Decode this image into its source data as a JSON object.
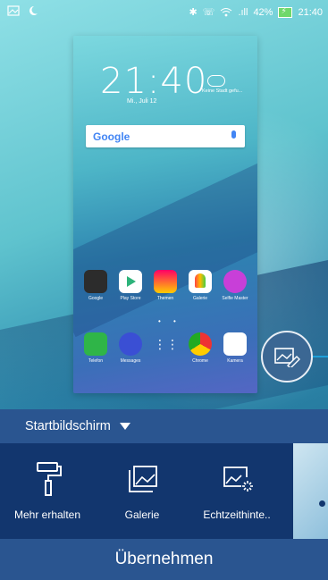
{
  "status_bar": {
    "battery": "42%",
    "time": "21:40",
    "icons": [
      "image-icon",
      "moon-icon",
      "bluetooth-icon",
      "call-icon",
      "wifi-icon",
      "signal-icon",
      "battery-icon"
    ]
  },
  "preview": {
    "clock": "21:40",
    "date": "Mi., Juli 12",
    "weather": "Keine Stadt gefu...",
    "search_logo": "Google",
    "apps_row1": [
      "Google",
      "Play Store",
      "Themen",
      "Galerie",
      "Selfie Master"
    ],
    "apps_row2": [
      "Telefon",
      "Messages",
      "",
      "Chrome",
      "Kamera"
    ]
  },
  "panel": {
    "dropdown_label": "Startbildschirm",
    "options": [
      {
        "label": "Mehr erhalten",
        "icon": "paint-roller-icon"
      },
      {
        "label": "Galerie",
        "icon": "gallery-icon"
      },
      {
        "label": "Echtzeithinte..",
        "icon": "live-wallpaper-icon"
      }
    ],
    "apply_label": "Übernehmen"
  },
  "colors": {
    "panel": "#2a5590",
    "options_bg": "#12366e",
    "callout": "#1e9fd8"
  }
}
